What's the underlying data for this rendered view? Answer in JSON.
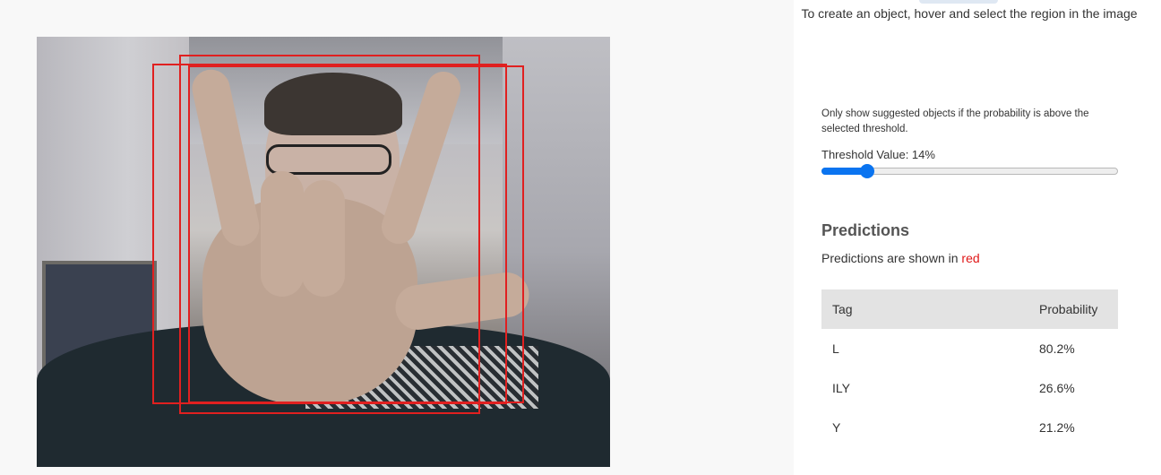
{
  "hint": {
    "text": "To create an object, hover and select the region in the image"
  },
  "threshold": {
    "help_text": "Only show suggested objects if the probability is above the selected threshold.",
    "label": "Threshold Value: 14%",
    "value_fraction": 0.14
  },
  "predictions": {
    "title": "Predictions",
    "note_prefix": "Predictions are shown in ",
    "note_color_word": "red",
    "columns": [
      "Tag",
      "Probability"
    ],
    "rows": [
      {
        "tag": "L",
        "probability": "80.2%"
      },
      {
        "tag": "ILY",
        "probability": "26.6%"
      },
      {
        "tag": "Y",
        "probability": "21.2%"
      }
    ]
  },
  "colors": {
    "prediction_box": "#e02020",
    "slider_accent": "#0a74f0",
    "table_header_bg": "#e3e3e3"
  }
}
